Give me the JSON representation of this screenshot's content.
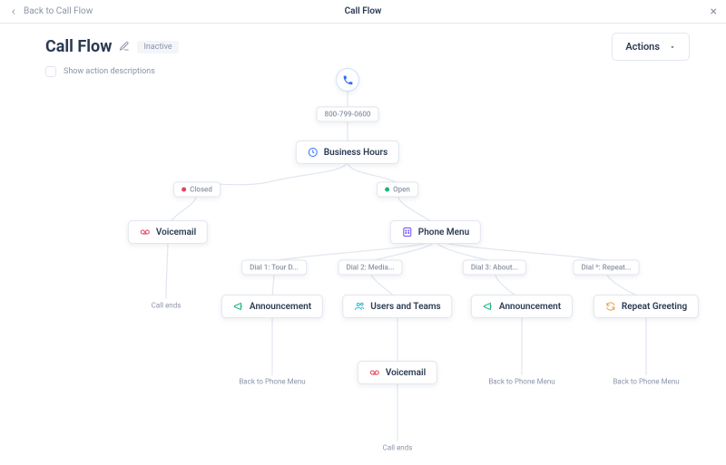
{
  "topbar": {
    "back": "Back to Call Flow",
    "title": "Call Flow"
  },
  "header": {
    "title": "Call Flow",
    "status": "Inactive",
    "actions_label": "Actions"
  },
  "options": {
    "show_descriptions": "Show action descriptions"
  },
  "start": {
    "phone": "800-799-0600"
  },
  "branches": {
    "closed": "Closed",
    "open": "Open"
  },
  "nodes": {
    "business_hours": "Business Hours",
    "voicemail": "Voicemail",
    "phone_menu": "Phone Menu",
    "announcement": "Announcement",
    "users_teams": "Users and Teams",
    "repeat_greeting": "Repeat Greeting"
  },
  "dial": {
    "d1": "Dial 1: Tour D...",
    "d2": "Dial 2: Media...",
    "d3": "Dial 3: About...",
    "dstar": "Dial *: Repeat..."
  },
  "terms": {
    "call_ends": "Call ends",
    "back_menu": "Back to Phone Menu"
  }
}
